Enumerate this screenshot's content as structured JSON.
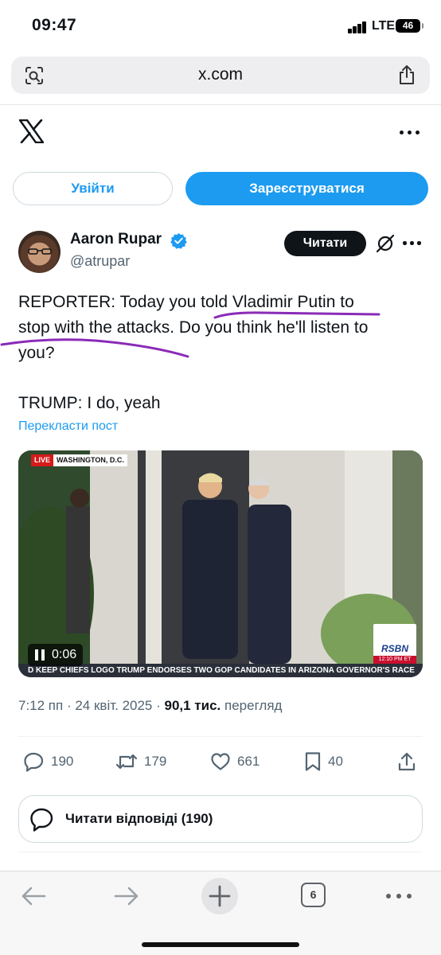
{
  "status_bar": {
    "time": "09:47",
    "network": "LTE",
    "battery": "46"
  },
  "browser": {
    "url": "x.com",
    "tab_count": "6"
  },
  "x_header": {
    "login_label": "Увійти",
    "signup_label": "Зареєструватися"
  },
  "post": {
    "author_name": "Aaron Rupar",
    "author_handle": "@atrupar",
    "read_label": "Читати",
    "text_lines": [
      "REPORTER: Today you told Vladimir Putin to",
      "stop with the attacks. Do you think he'll listen to",
      "you?"
    ],
    "text_second": "TRUMP: I do, yeah",
    "translate_label": "Перекласти пост",
    "video": {
      "live_label": "LIVE",
      "location": "WASHINGTON, D.C.",
      "ticker": "D KEEP CHIEFS LOGO     TRUMP ENDORSES TWO GOP CANDIDATES IN ARIZONA GOVERNOR'S RACE",
      "logo": "RSBN",
      "logo_time": "12:10 PM ET",
      "duration": "0:06"
    },
    "meta": {
      "time": "7:12 пп",
      "date": "24 квіт. 2025",
      "views": "90,1 тис.",
      "views_label": "перегляд"
    },
    "actions": {
      "replies": "190",
      "reposts": "179",
      "likes": "661",
      "bookmarks": "40"
    },
    "read_replies_label": "Читати відповіді (190)"
  },
  "colors": {
    "accent": "#1d9bf0",
    "text": "#0f1419",
    "muted": "#536471",
    "annotation": "#8a2bb8"
  }
}
